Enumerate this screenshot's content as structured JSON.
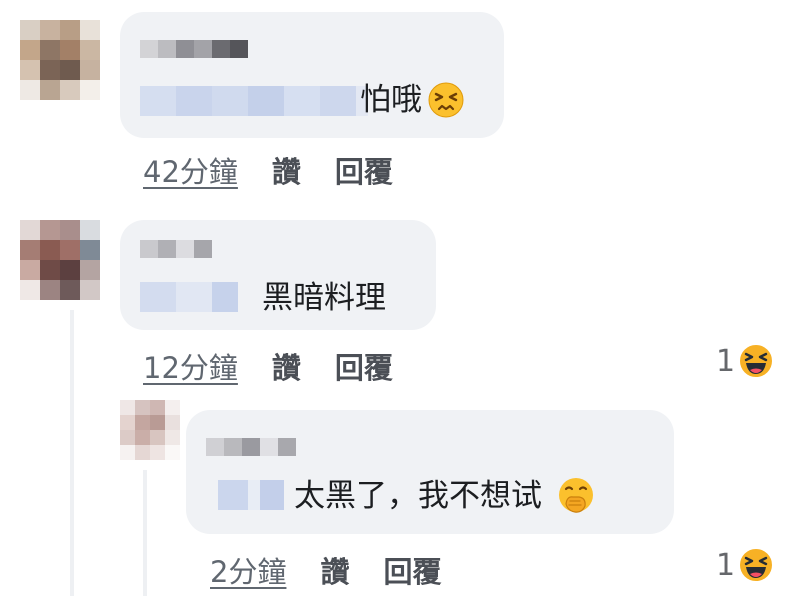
{
  "comments": [
    {
      "text": "怕哦",
      "emoji": "persevering-face-emoji",
      "time": "42分鐘",
      "like": "讚",
      "reply": "回覆",
      "reaction_count": ""
    },
    {
      "text": "黑暗料理",
      "emoji": "",
      "time": "12分鐘",
      "like": "讚",
      "reply": "回覆",
      "reaction_count": "1",
      "reaction_icon": "haha-reaction-icon"
    },
    {
      "text": "太黑了，我不想试",
      "emoji": "face-with-hand-over-mouth-emoji",
      "time": "2分鐘",
      "like": "讚",
      "reply": "回覆",
      "reaction_count": "1",
      "reaction_icon": "haha-reaction-icon"
    }
  ],
  "colors": {
    "bubble": "#f0f2f5",
    "meta": "#606770",
    "text": "#1c1e21",
    "haha": "#f7b125"
  }
}
